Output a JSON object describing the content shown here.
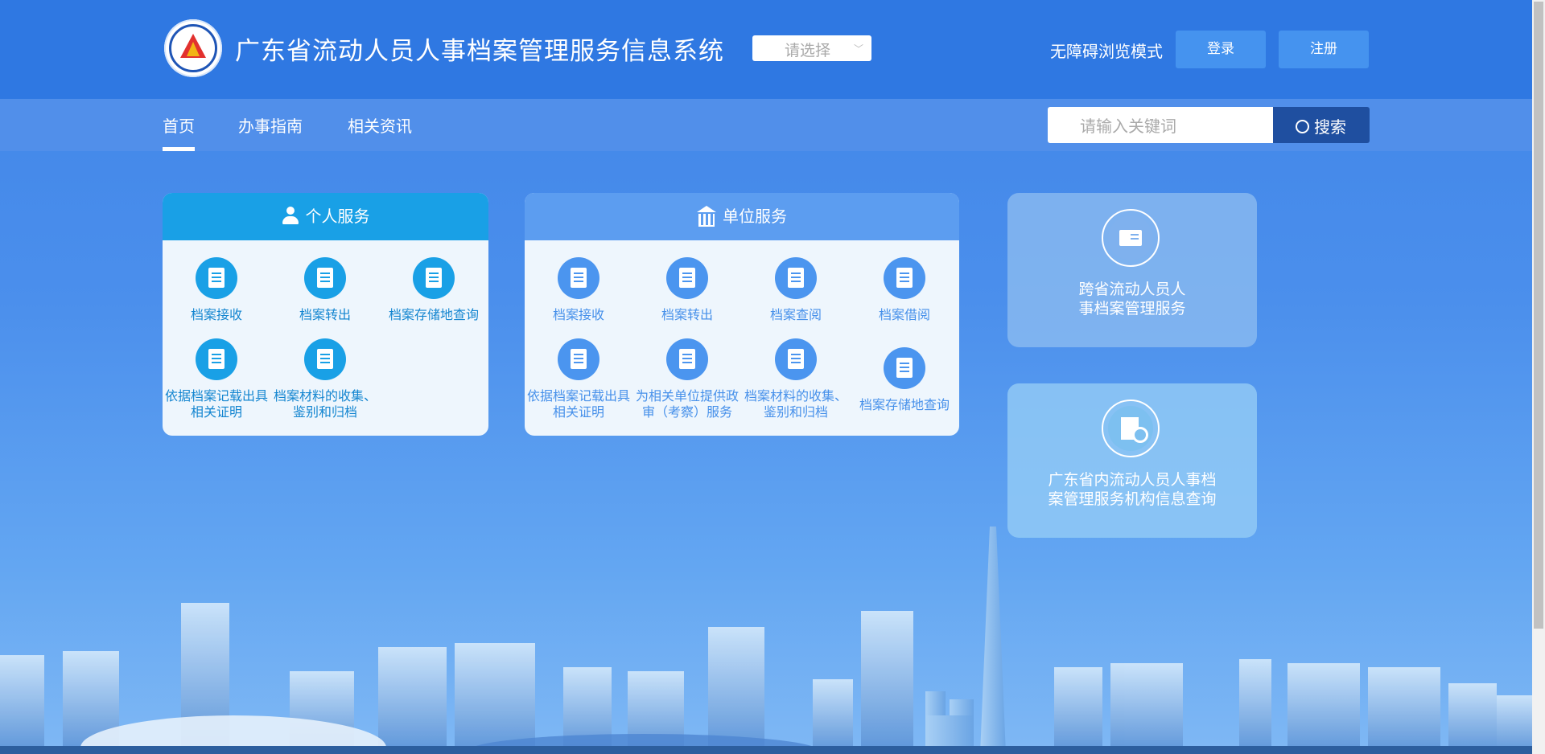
{
  "header": {
    "site_title": "广东省流动人员人事档案管理服务信息系统",
    "region_select": {
      "value": "请选择"
    },
    "accessibility_link": "无障碍浏览模式",
    "login_label": "登录",
    "register_label": "注册"
  },
  "nav": {
    "items": [
      {
        "label": "首页",
        "active": true
      },
      {
        "label": "办事指南",
        "active": false
      },
      {
        "label": "相关资讯",
        "active": false
      }
    ],
    "search": {
      "placeholder": "请输入关键词",
      "button_label": "搜索"
    }
  },
  "personal_services": {
    "title": "个人服务",
    "items": [
      {
        "label": "档案接收",
        "icon": "file-receive-icon"
      },
      {
        "label": "档案转出",
        "icon": "file-transfer-icon"
      },
      {
        "label": "档案存储地查询",
        "icon": "file-search-icon"
      },
      {
        "label": "依据档案记载出具\n相关证明",
        "icon": "certificate-icon"
      },
      {
        "label": "档案材料的收集、\n鉴别和归档",
        "icon": "archive-icon"
      }
    ]
  },
  "unit_services": {
    "title": "单位服务",
    "items": [
      {
        "label": "档案接收",
        "icon": "file-receive-icon"
      },
      {
        "label": "档案转出",
        "icon": "file-transfer-icon"
      },
      {
        "label": "档案查阅",
        "icon": "book-icon"
      },
      {
        "label": "档案借阅",
        "icon": "file-borrow-icon"
      },
      {
        "label": "依据档案记载出具\n相关证明",
        "icon": "certificate-icon"
      },
      {
        "label": "为相关单位提供政\n审（考察）服务",
        "icon": "review-icon"
      },
      {
        "label": "档案材料的收集、\n鉴别和归档",
        "icon": "archive-icon"
      },
      {
        "label": "档案存储地查询",
        "icon": "file-search-icon"
      }
    ]
  },
  "side_tiles": [
    {
      "label": "跨省流动人员人\n事档案管理服务",
      "icon": "id-card-icon"
    },
    {
      "label": "广东省内流动人员人事档\n案管理服务机构信息查询",
      "icon": "building-search-icon"
    }
  ],
  "colors": {
    "header_bg": "#2f78e2",
    "nav_bg": "#518fea",
    "personal_header": "#19a0e6",
    "unit_header": "#5c9df0",
    "search_button": "#1f4fa0"
  }
}
